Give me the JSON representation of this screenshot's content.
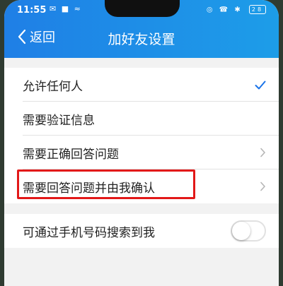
{
  "status_bar": {
    "time": "11:55",
    "icons_left": "✉ ■ ≈",
    "icons_right": "◎ ☎ ✱",
    "battery": "28"
  },
  "nav": {
    "back_label": "返回",
    "title": "加好友设置"
  },
  "options": [
    {
      "label": "允许任何人",
      "state": "selected"
    },
    {
      "label": "需要验证信息",
      "state": "none"
    },
    {
      "label": "需要正确回答问题",
      "state": "chevron"
    },
    {
      "label": "需要回答问题并由我确认",
      "state": "chevron"
    }
  ],
  "search_by_phone": {
    "label": "可通过手机号码搜索到我",
    "enabled": false
  },
  "colors": {
    "header_start": "#1f7fe6",
    "header_end": "#1d9de8",
    "highlight": "#e21818",
    "check": "#1a73e8"
  }
}
